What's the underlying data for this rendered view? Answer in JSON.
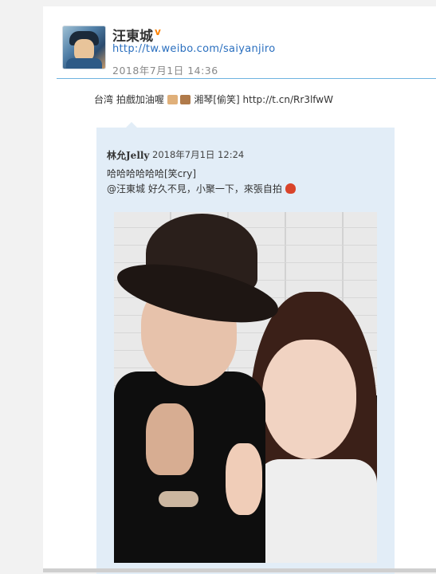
{
  "post": {
    "user_name": "汪東城",
    "profile_link": "http://tw.weibo.com/saiyanjiro",
    "time": "2018年7月1日 14:36",
    "text_part1": "台湾 拍戲加油喔",
    "text_part2": "湘琴[偷笑]",
    "text_link": "http://t.cn/Rr3lfwW"
  },
  "repost": {
    "user_name": "林允Jelly",
    "time": "2018年7月1日 12:24",
    "line1": "哈哈哈哈哈哈[笑cry]",
    "line2": "@汪東城 好久不見，小聚一下，來張自拍"
  },
  "icons": {
    "verified": "verified-v-icon",
    "emoji_flex": "flexed-biceps-icon",
    "emoji_box": "box-icon",
    "emoji_food": "chili-icon"
  },
  "colors": {
    "link": "#2a6fbf",
    "verified": "#ff8200",
    "divider": "#6fb3e0",
    "repost_bg": "#e2edf7"
  }
}
